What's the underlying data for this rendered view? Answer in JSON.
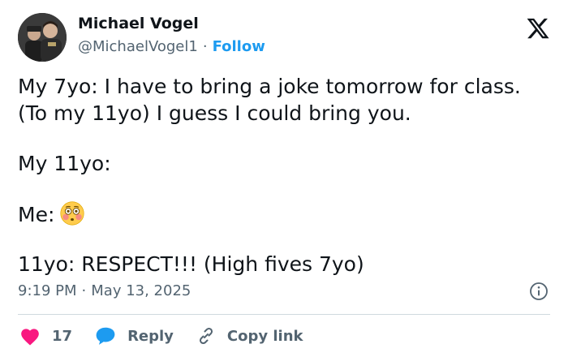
{
  "author": {
    "name": "Michael Vogel",
    "handle": "@MichaelVogel1",
    "separator": "·",
    "follow_label": "Follow"
  },
  "tweet": {
    "lines": [
      "My 7yo: I have to bring a joke tomorrow for class.",
      "(To my 11yo) I guess I could bring you.",
      "My 11yo:",
      "Me:",
      "11yo: RESPECT!!! (High fives 7yo)"
    ],
    "emoji": "flushed-face-emoji"
  },
  "meta": {
    "time": "9:19 PM",
    "separator": "·",
    "date": "May 13, 2025"
  },
  "actions": {
    "like_count": "17",
    "reply_label": "Reply",
    "copy_link_label": "Copy link"
  },
  "colors": {
    "link": "#1d9bf0",
    "like": "#f91880",
    "text": "#0f1419",
    "muted": "#536471",
    "divider": "#cfd9de"
  },
  "icons": [
    "avatar",
    "x-logo-icon",
    "info-icon",
    "heart-icon",
    "reply-bubble-icon",
    "link-icon"
  ]
}
